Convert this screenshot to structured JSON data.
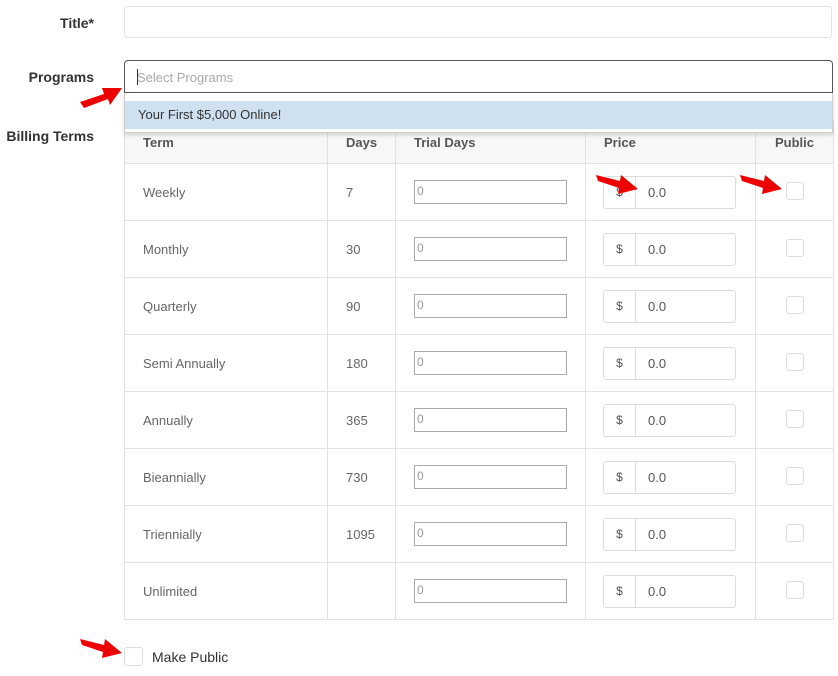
{
  "form": {
    "title_label": "Title*",
    "title_value": "",
    "programs_label": "Programs",
    "programs_placeholder": "Select Programs",
    "programs_options": [
      "Your First $5,000 Online!"
    ],
    "billing_label": "Billing Terms",
    "make_public_label": "Make Public"
  },
  "table": {
    "headers": {
      "term": "Term",
      "days": "Days",
      "trial_days": "Trial Days",
      "price": "Price",
      "public": "Public"
    },
    "currency_symbol": "$",
    "rows": [
      {
        "term": "Weekly",
        "days": "7",
        "trial": "0",
        "price": "0.0"
      },
      {
        "term": "Monthly",
        "days": "30",
        "trial": "0",
        "price": "0.0"
      },
      {
        "term": "Quarterly",
        "days": "90",
        "trial": "0",
        "price": "0.0"
      },
      {
        "term": "Semi Annually",
        "days": "180",
        "trial": "0",
        "price": "0.0"
      },
      {
        "term": "Annually",
        "days": "365",
        "trial": "0",
        "price": "0.0"
      },
      {
        "term": "Bieannially",
        "days": "730",
        "trial": "0",
        "price": "0.0"
      },
      {
        "term": "Triennially",
        "days": "1095",
        "trial": "0",
        "price": "0.0"
      },
      {
        "term": "Unlimited",
        "days": "",
        "trial": "0",
        "price": "0.0"
      }
    ]
  },
  "colors": {
    "annotation_arrow": "#ee0000",
    "dropdown_highlight": "#cfe1f0"
  }
}
